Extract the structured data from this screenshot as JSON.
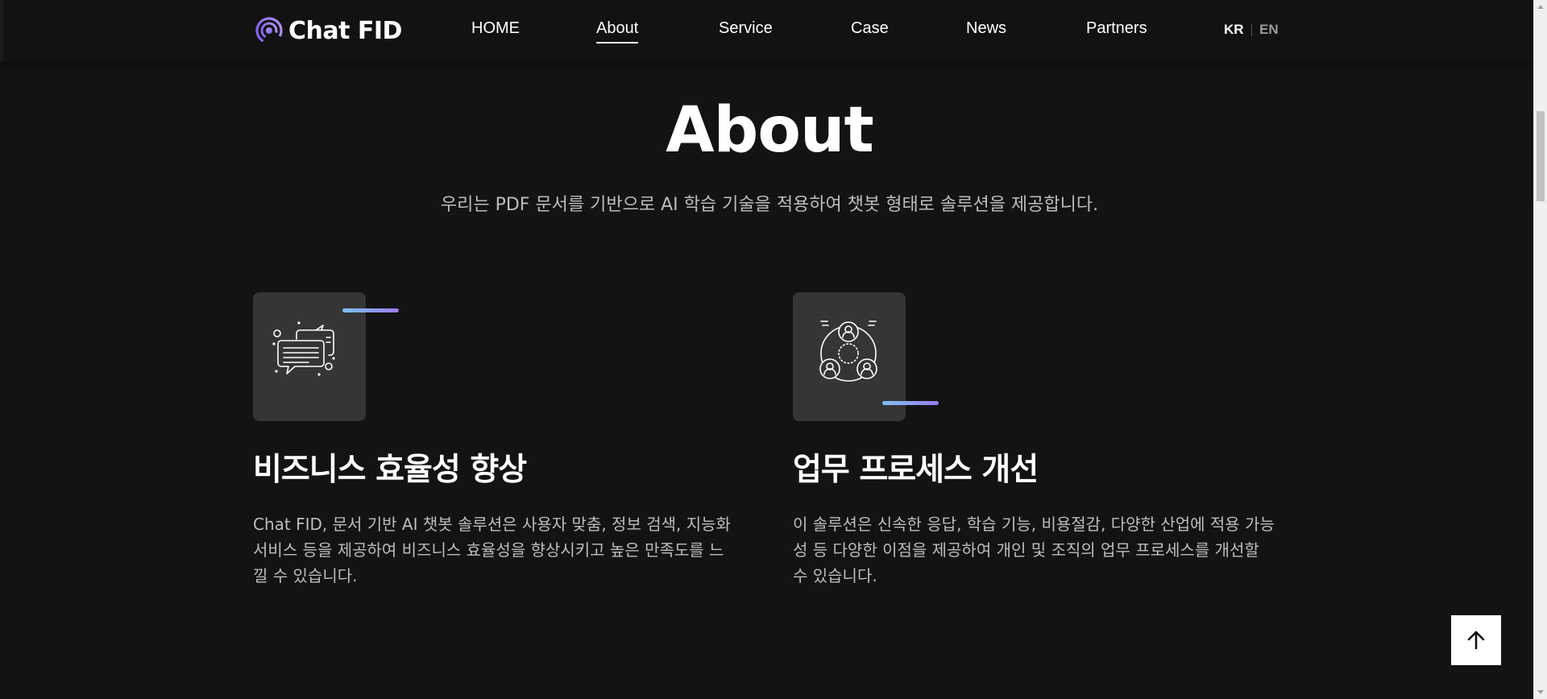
{
  "header": {
    "logo_text": "Chat FID",
    "nav": [
      "HOME",
      "About",
      "Service",
      "Case",
      "News",
      "Partners"
    ],
    "active_nav": "About",
    "lang": {
      "kr": "KR",
      "en": "EN",
      "active": "KR"
    }
  },
  "hero": {
    "title": "About",
    "subtitle": "우리는 PDF 문서를 기반으로 AI 학습 기술을 적용하여 챗봇 형태로 솔루션을 제공합니다."
  },
  "features": [
    {
      "icon": "chat-bubbles-icon",
      "title": "비즈니스 효율성 향상",
      "text": "Chat FID, 문서 기반 AI 챗봇 솔루션은 사용자 맞춤, 정보 검색, 지능화 서비스 등을 제공하여 비즈니스 효율성을 향상시키고 높은 만족도를 느낄 수 있습니다."
    },
    {
      "icon": "team-network-icon",
      "title": "업무 프로세스 개선",
      "text": "이 솔루션은 신속한 응답, 학습 기능, 비용절감, 다양한 산업에 적용 가능성 등 다양한 이점을 제공하여 개인 및 조직의 업무 프로세스를 개선할 수 있습니다."
    }
  ],
  "back_to_top_icon": "arrow-up-icon",
  "colors": {
    "background": "#131313",
    "accent_gradient": [
      "#7ec3f0",
      "#9a7bf0"
    ],
    "logo_purple": "#8d6cf0"
  }
}
